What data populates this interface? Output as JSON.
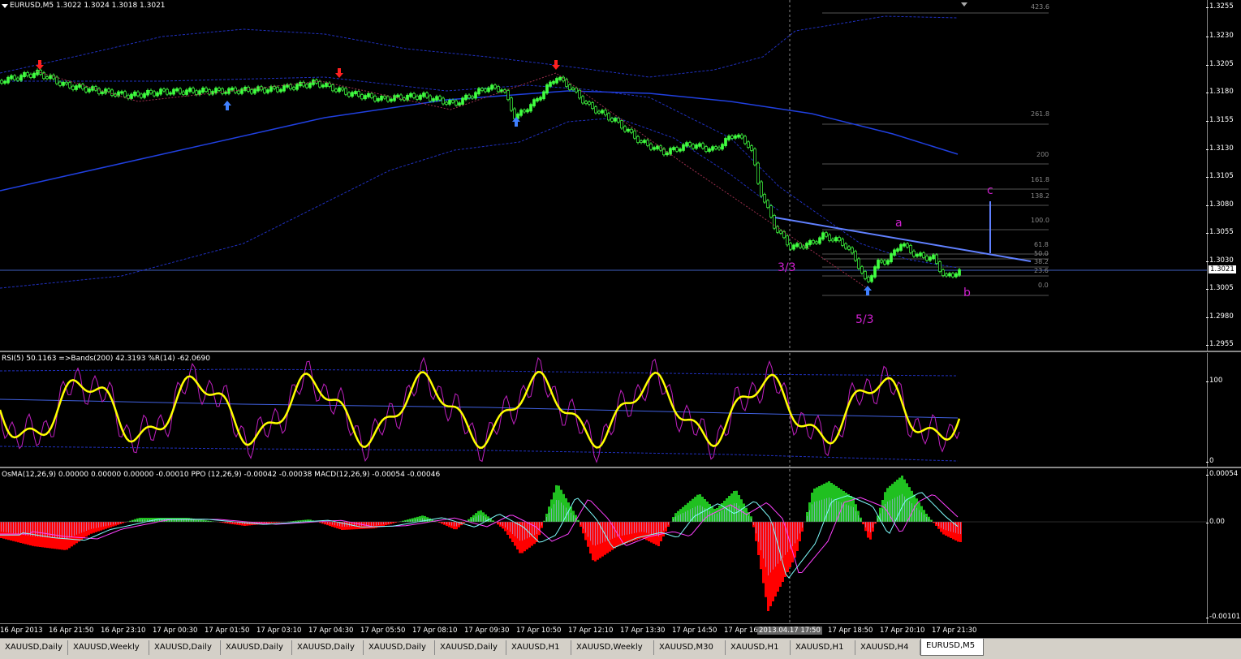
{
  "main": {
    "title": "EURUSD,M5  1.3022 1.3024 1.3018 1.3021",
    "current_price": "1.3021",
    "price_ticks": [
      "1.3255",
      "1.3230",
      "1.3205",
      "1.3180",
      "1.3155",
      "1.3130",
      "1.3105",
      "1.3080",
      "1.3055",
      "1.3030",
      "1.3005",
      "1.2980",
      "1.2955"
    ],
    "fib_levels": [
      "423.6",
      "261.8",
      "200",
      "161.8",
      "138.2",
      "100.0",
      "61.8",
      "50.0",
      "38.2",
      "23.6",
      "0.0"
    ],
    "wave_labels": {
      "a": "a",
      "b": "b",
      "c": "c",
      "w33": "3/3",
      "w53": "5/3"
    }
  },
  "rsi": {
    "title": "RSI(5) 50.1163  =>Bands(200) 42.3193  %R(14) -62.0690",
    "ticks": [
      "100",
      "0"
    ]
  },
  "macd": {
    "title": "OsMA(12,26,9) 0.00000 0.00000 0.00000 -0.00010  PPO (12,26,9) -0.00042 -0.00038  MACD(12,26,9) -0.00054 -0.00046",
    "ticks": [
      "0.00054",
      "0.00",
      "-0.00101"
    ]
  },
  "time_axis": {
    "labels": [
      "16 Apr 2013",
      "16 Apr 21:50",
      "16 Apr 23:10",
      "17 Apr 00:30",
      "17 Apr 01:50",
      "17 Apr 03:10",
      "17 Apr 04:30",
      "17 Apr 05:50",
      "17 Apr 08:10",
      "17 Apr 09:30",
      "17 Apr 10:50",
      "17 Apr 12:10",
      "17 Apr 13:30",
      "17 Apr 14:50",
      "17 Apr 16",
      "17 Apr 18:50",
      "17 Apr 20:10",
      "17 Apr 21:30"
    ],
    "cursor_label": "2013.04.17 17:50"
  },
  "tabs": [
    "XAUUSD,Daily",
    "XAUUSD,Weekly",
    "XAUUSD,Daily",
    "XAUUSD,Daily",
    "XAUUSD,Daily",
    "XAUUSD,Daily",
    "XAUUSD,Daily",
    "XAUUSD,H1",
    "XAUUSD,Weekly",
    "XAUUSD,M30",
    "XAUUSD,H1",
    "XAUUSD,H1",
    "XAUUSD,H4",
    "EURUSD,M5"
  ],
  "active_tab": "EURUSD,M5",
  "colors": {
    "candles": "#40ff40",
    "bands": "#2030c0",
    "ma": "#2040e0",
    "rsi": "#ffff00",
    "wpr": "#c020c0",
    "hist_up": "#20c020",
    "hist_down": "#ff0000",
    "wave_text": "#d020d0",
    "trendline": "#6080ff"
  },
  "icons": [
    "dropdown-icon",
    "sell-arrow-icon",
    "buy-arrow-icon"
  ]
}
